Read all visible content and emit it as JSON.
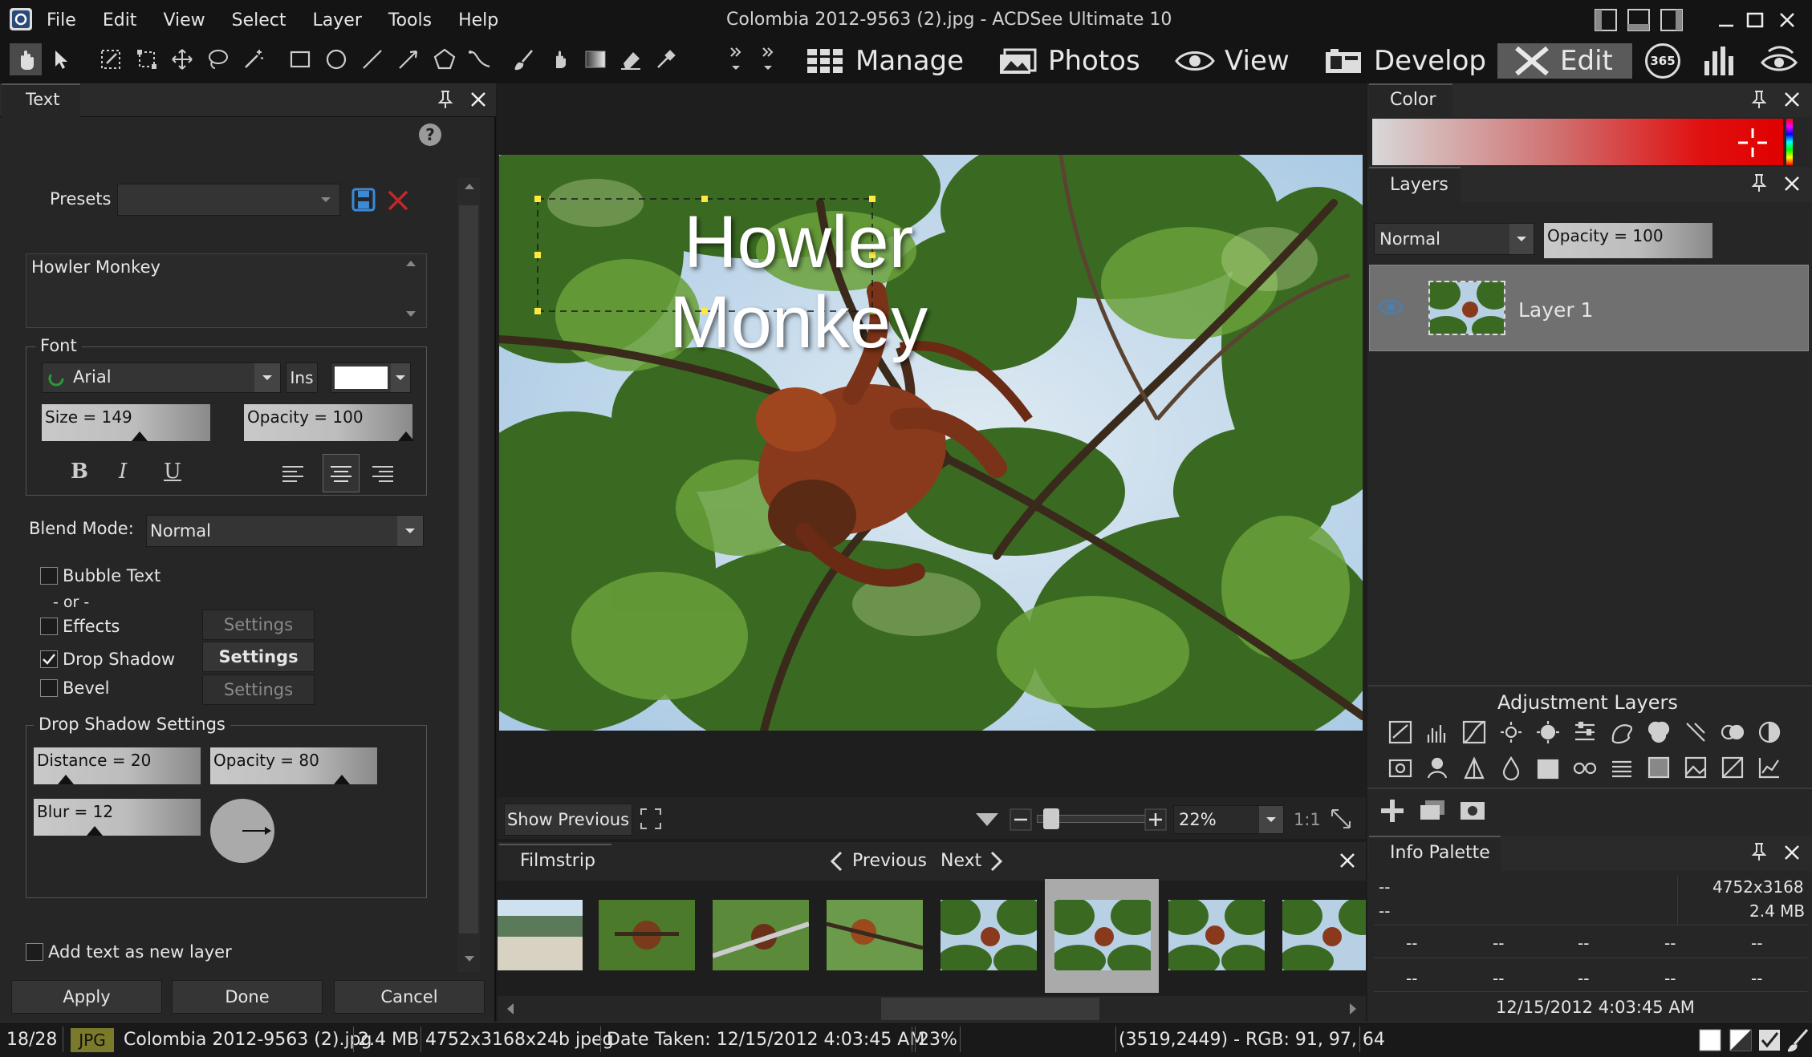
{
  "window": {
    "title": "Colombia 2012-9563 (2).jpg - ACDSee Ultimate 10",
    "app_icon": "acdsee-logo-icon",
    "controls": [
      "layout-left-icon",
      "layout-bottom-icon",
      "layout-right-icon",
      "minimize-icon",
      "maximize-icon",
      "close-icon"
    ]
  },
  "menu": [
    "File",
    "Edit",
    "View",
    "Select",
    "Layer",
    "Tools",
    "Help"
  ],
  "modes": {
    "manage": "Manage",
    "photos": "Photos",
    "view": "View",
    "develop": "Develop",
    "edit": "Edit",
    "badge_365": "365"
  },
  "text_panel": {
    "title": "Text",
    "presets_label": "Presets",
    "presets_value": "",
    "text_value": "Howler Monkey",
    "font_group": "Font",
    "font_name": "Arial",
    "ins_label": "Ins",
    "size_slider": "Size = 149",
    "size_value": 149,
    "opacity_slider": "Opacity = 100",
    "opacity_value": 100,
    "bold": "B",
    "italic": "I",
    "underline": "U",
    "blend_mode_label": "Blend Mode:",
    "blend_mode_value": "Normal",
    "bubble_text": "Bubble Text",
    "or_label": "- or -",
    "effects": "Effects",
    "drop_shadow": "Drop Shadow",
    "bevel": "Bevel",
    "settings_label": "Settings",
    "shadow_group": "Drop Shadow Settings",
    "distance_slider": "Distance = 20",
    "distance_value": 20,
    "shadow_opacity_slider": "Opacity = 80",
    "shadow_opacity_value": 80,
    "blur_slider": "Blur = 12",
    "blur_value": 12,
    "add_as_layer": "Add text as new layer",
    "apply": "Apply",
    "done": "Done",
    "cancel": "Cancel",
    "drop_shadow_checked": true
  },
  "canvas": {
    "overlay_line1": "Howler",
    "overlay_line2": "Monkey",
    "show_previous": "Show Previous",
    "zoom": "22%",
    "zoom_ratio": "1:1"
  },
  "filmstrip": {
    "title": "Filmstrip",
    "previous": "Previous",
    "next": "Next",
    "selected_index": 5,
    "count": 8
  },
  "color_panel": {
    "title": "Color"
  },
  "layers_panel": {
    "title": "Layers",
    "blend": "Normal",
    "opacity": "Opacity = 100",
    "layer_name": "Layer 1"
  },
  "adjustment_layers": {
    "title": "Adjustment Layers"
  },
  "info_palette": {
    "title": "Info Palette",
    "row1_left": "--",
    "row1_right": "4752x3168",
    "row2_left": "--",
    "row2_right": "2.4 MB",
    "dash": "--",
    "date": "12/15/2012 4:03:45 AM"
  },
  "status": {
    "index": "18/28",
    "format": "JPG",
    "filename": "Colombia 2012-9563 (2).jpg",
    "size": "2.4 MB",
    "dimensions": "4752x3168x24b jpeg",
    "date_taken": "Date Taken: 12/15/2012 4:03:45 AM",
    "zoom": "23%",
    "coords": "(3519,2449) - RGB: 91, 97, 64"
  },
  "colors": {
    "accent_edit": "#5a5a5a",
    "jpg_badge": "#7a7a2a",
    "layer_selected": "#707070"
  }
}
